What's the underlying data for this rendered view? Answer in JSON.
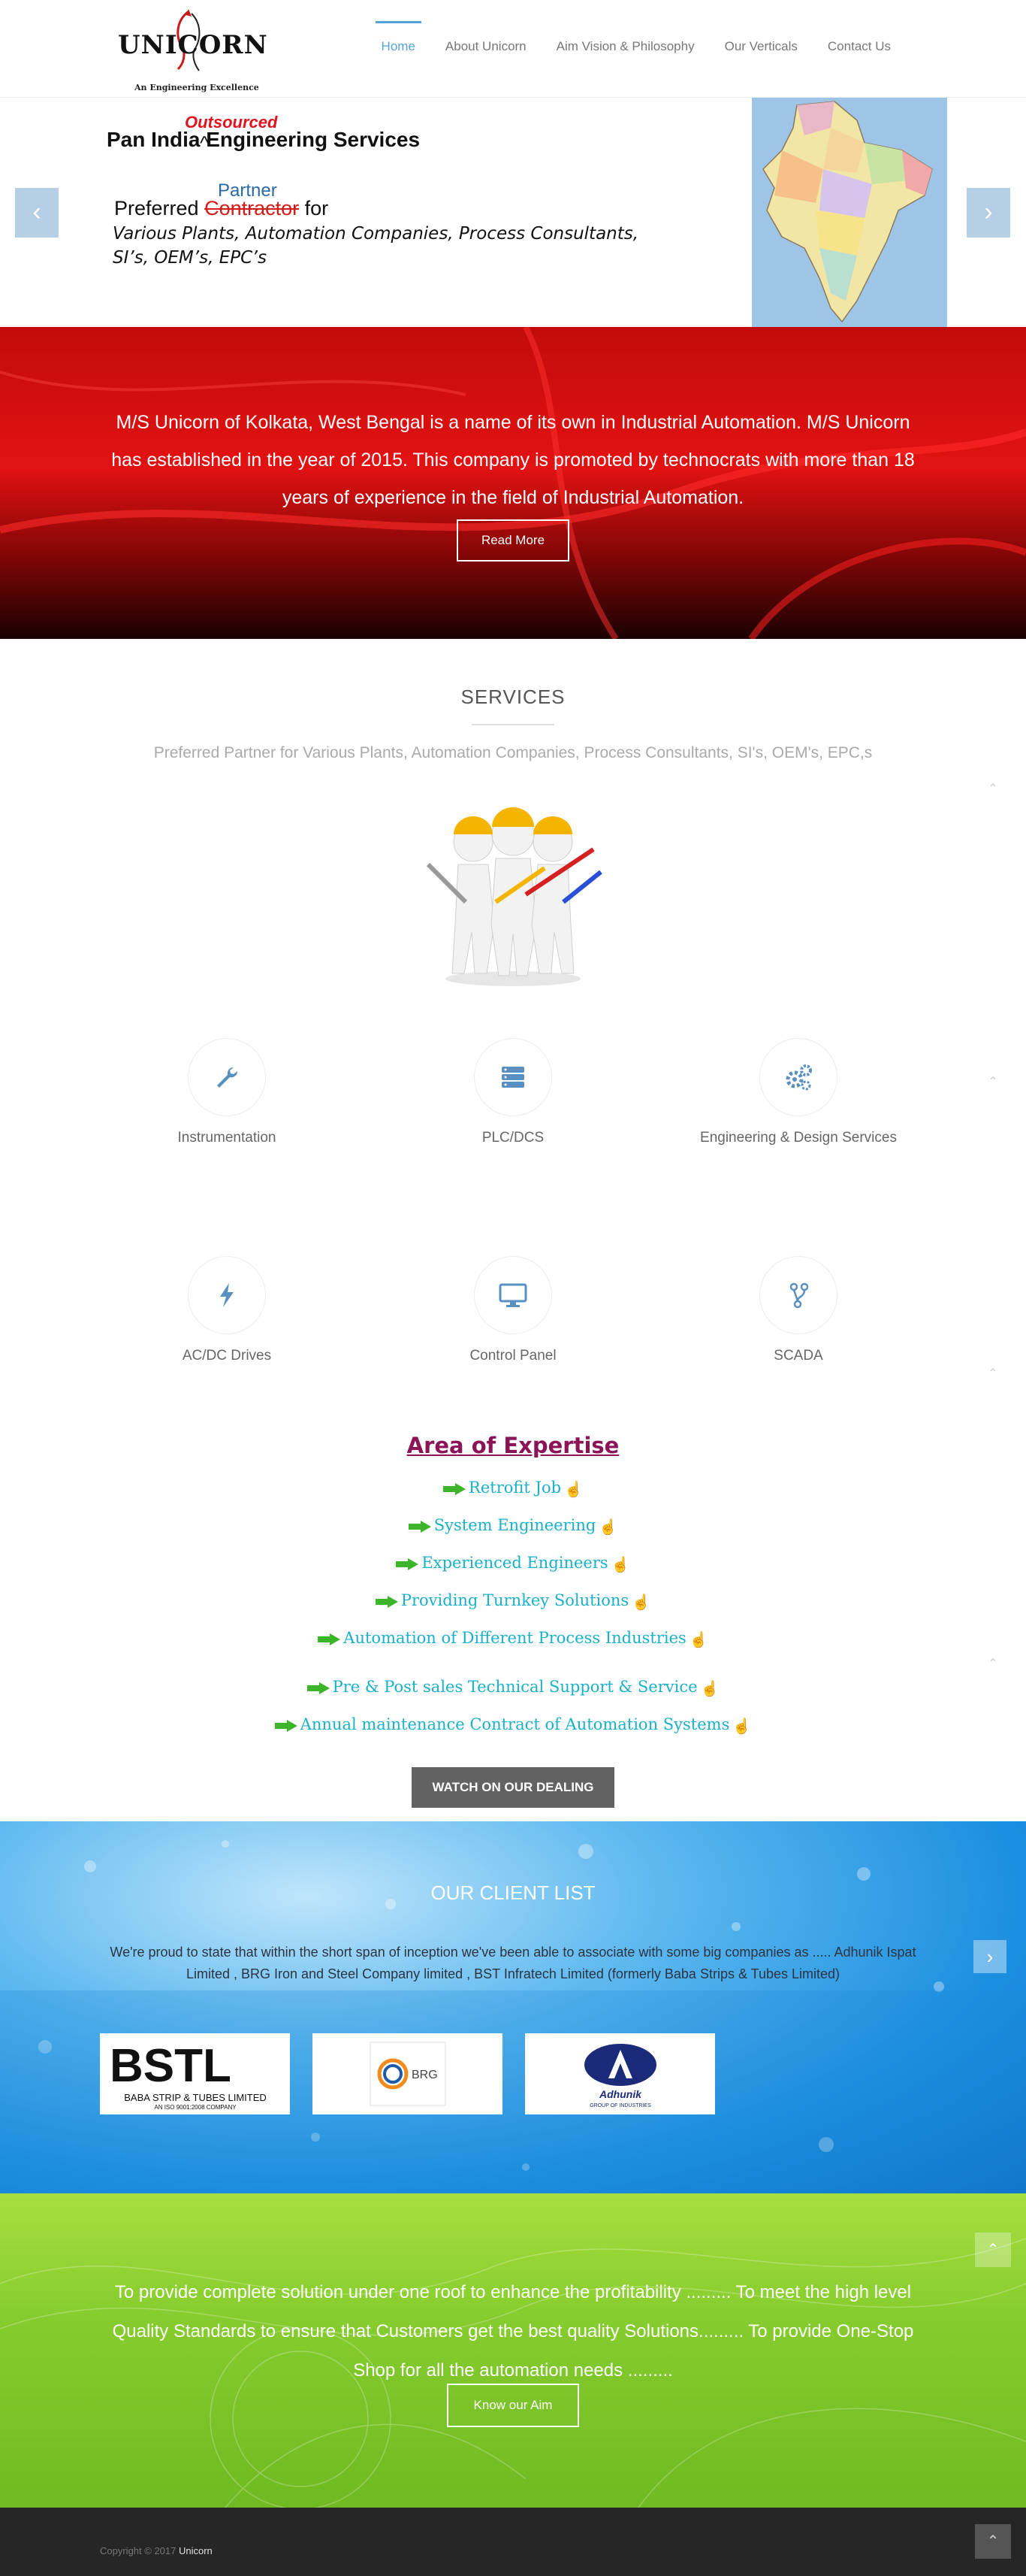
{
  "header": {
    "logo_text": "UNICORN",
    "logo_tagline": "An Engineering Excellence",
    "nav": [
      {
        "label": "Home"
      },
      {
        "label": "About Unicorn"
      },
      {
        "label": "Aim Vision & Philosophy"
      },
      {
        "label": "Our Verticals"
      },
      {
        "label": "Contact Us"
      }
    ]
  },
  "slider": {
    "headline": "Pan India      Engineering Services",
    "inserted_word": "Outsourced",
    "caret": "^",
    "partner_word": "Partner",
    "preferred": "Preferred",
    "struck_word": "Contractor",
    "for_word": "for",
    "list_line1": "Various Plants, Automation Companies, Process Consultants,",
    "list_line2": "SI’s,  OEM’s, EPC’s",
    "prev_icon": "chevron-left",
    "next_icon": "chevron-right"
  },
  "about": {
    "text": "M/S Unicorn of Kolkata, West Bengal is a name of its own in Industrial Automation. M/S Unicorn has established in the year of 2015. This company is promoted by technocrats with more than 18 years of experience in the field of Industrial Automation.",
    "button": "Read More"
  },
  "services": {
    "title": "SERVICES",
    "subtitle": "Preferred Partner for Various Plants, Automation Companies, Process Consultants, SI's, OEM's, EPC,s",
    "items": [
      {
        "label": "Instrumentation",
        "icon": "wrench-icon"
      },
      {
        "label": "PLC/DCS",
        "icon": "server-icon"
      },
      {
        "label": "Engineering & Design Services",
        "icon": "gears-icon"
      },
      {
        "label": "AC/DC Drives",
        "icon": "bolt-icon"
      },
      {
        "label": "Control Panel",
        "icon": "monitor-icon"
      },
      {
        "label": "SCADA",
        "icon": "fork-icon"
      }
    ]
  },
  "expertise": {
    "title": "Area of Expertise",
    "items": [
      "Retrofit Job",
      "System Engineering",
      "Experienced Engineers",
      "Providing Turnkey Solutions",
      "Automation of Different Process Industries",
      "Pre & Post sales Technical Support & Service",
      "Annual maintenance Contract of Automation Systems"
    ],
    "button": "WATCH ON OUR DEALING"
  },
  "clients": {
    "title": "OUR CLIENT LIST",
    "text": "We're proud to state that within the short span of inception we've been able to associate with some big companies as .....  Adhunik Ispat Limited , BRG Iron and Steel Company limited , BST Infratech Limited (formerly Baba Strips & Tubes Limited)",
    "logos": [
      {
        "name": "BSTL",
        "caption": "BABA STRIP & TUBES LIMITED",
        "sub": "AN ISO 9001:2008 COMPANY"
      },
      {
        "name": "BRG"
      },
      {
        "name": "Adhunik",
        "sub": "GROUP OF INDUSTRIES"
      }
    ]
  },
  "aim": {
    "text": "To provide complete solution under one roof to enhance the profitability ......... To meet the high level Quality Standards to ensure that Customers get the best quality Solutions......... To provide One-Stop Shop for all the automation needs .........",
    "button": "Know our Aim"
  },
  "footer": {
    "copyright": "Copyright © 2017",
    "brand": "Unicorn"
  },
  "colors": {
    "accent": "#59a2d8",
    "expertise_title": "#8b1456",
    "expertise_item": "#18b1c9"
  }
}
